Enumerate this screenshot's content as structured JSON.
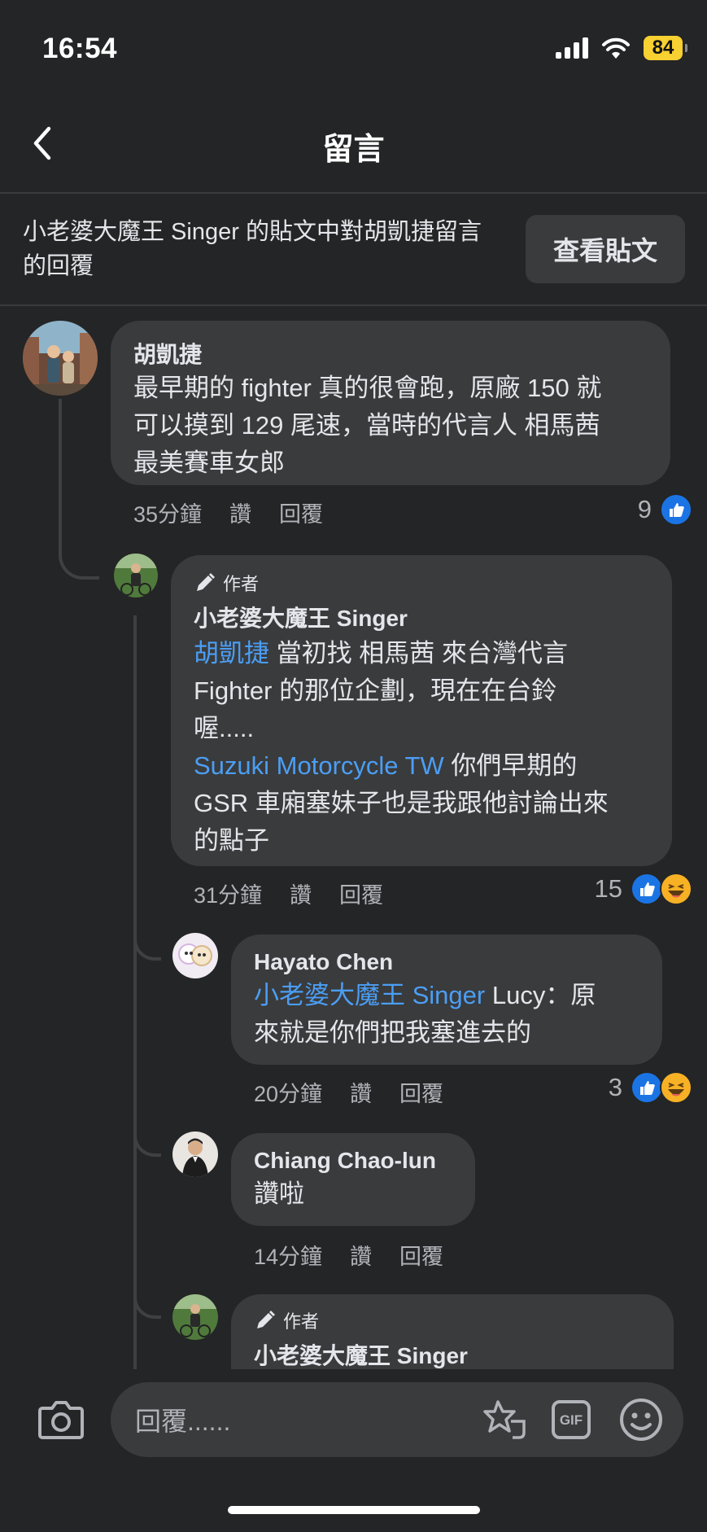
{
  "status_bar": {
    "time": "16:54",
    "battery": "84"
  },
  "header": {
    "title": "留言"
  },
  "context": {
    "text": "小老婆大魔王 Singer 的貼文中對胡凱捷留言的回覆",
    "view_post_label": "查看貼文"
  },
  "comments": [
    {
      "name": "胡凱捷",
      "lines": [
        "最早期的 fighter 真的很會跑，原廠 150 就",
        "可以摸到 129 尾速，當時的代言人 相馬茜",
        "最美賽車女郎"
      ],
      "time": "35分鐘",
      "like_label": "讚",
      "reply_label": "回覆",
      "reactions": "9"
    },
    {
      "author_badge": "作者",
      "name": "小老婆大魔王 Singer",
      "mention1": "胡凱捷",
      "line1_rest": " 當初找 相馬茜 來台灣代言",
      "line2": "Fighter 的那位企劃，現在在台鈴",
      "line3": "喔.....",
      "mention2": "Suzuki Motorcycle TW",
      "line4_rest": " 你們早期的",
      "line5": "GSR 車廂塞妹子也是我跟他討論出來",
      "line6": "的點子",
      "time": "31分鐘",
      "like_label": "讚",
      "reply_label": "回覆",
      "reactions": "15"
    },
    {
      "name": "Hayato Chen",
      "mention": "小老婆大魔王 Singer",
      "line1_rest": " Lucy：原",
      "line2": "來就是你們把我塞進去的",
      "time": "20分鐘",
      "like_label": "讚",
      "reply_label": "回覆",
      "reactions": "3"
    },
    {
      "name": "Chiang Chao-lun",
      "line1": "讚啦",
      "time": "14分鐘",
      "like_label": "讚",
      "reply_label": "回覆"
    },
    {
      "author_badge": "作者",
      "name": "小老婆大魔王 Singer"
    }
  ],
  "composer": {
    "placeholder": "回覆......"
  },
  "icons": {
    "back": "chevron-left-icon",
    "camera": "camera-icon",
    "sticker": "sticker-icon",
    "gif": "gif-icon",
    "emoji": "emoji-icon",
    "like": "like-icon",
    "haha": "haha-icon",
    "pen": "pen-icon",
    "signal": "signal-icon",
    "wifi": "wifi-icon"
  },
  "colors": {
    "background": "#242526",
    "bubble": "#3a3b3c",
    "mention": "#4b9ef5",
    "like": "#1b74e4",
    "battery": "#f7d031"
  }
}
